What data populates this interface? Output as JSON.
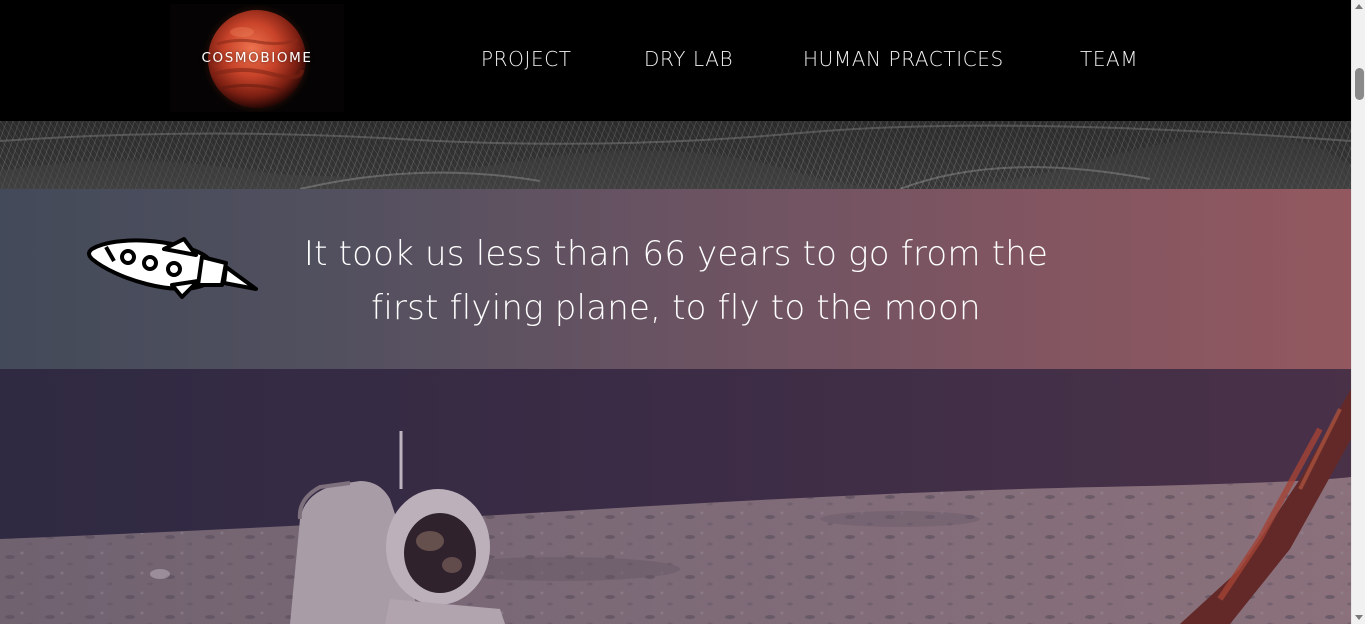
{
  "navbar": {
    "logo_text": "COSMOBIOME",
    "links": [
      {
        "label": "PROJECT"
      },
      {
        "label": "DRY LAB"
      },
      {
        "label": "HUMAN PRACTICES"
      },
      {
        "label": "TEAM"
      }
    ]
  },
  "hero_quote": {
    "line1": "It took us less than 66 years to go from the",
    "line2": "first flying plane, to fly to the moon",
    "icon": "rocket-icon"
  },
  "colors": {
    "navbar_bg": "#000000",
    "quote_gradient_start": "#434a59",
    "quote_gradient_end": "#93585f",
    "planet": "#c9442a"
  },
  "icons": {
    "logo": "planet-mars-logo",
    "quote": "rocket-icon",
    "engraving": "engraving-image",
    "moon": "astronaut-moon-image"
  }
}
